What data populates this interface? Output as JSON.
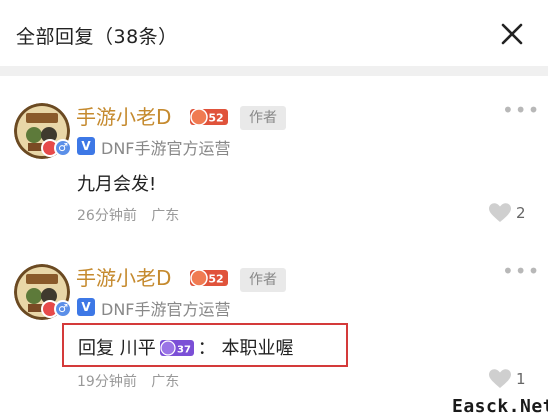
{
  "header": {
    "title": "全部回复（38条）"
  },
  "comments": [
    {
      "username": "手游小老D",
      "level": "52",
      "author_tag": "作者",
      "verify_label": "V",
      "verify_text": "DNF手游官方运营",
      "content": "九月会发!",
      "time": "26分钟前",
      "location": "广东",
      "likes": "2"
    },
    {
      "username": "手游小老D",
      "level": "52",
      "author_tag": "作者",
      "verify_label": "V",
      "verify_text": "DNF手游官方运营",
      "reply_prefix": "回复",
      "reply_to": "川平",
      "reply_to_level": "37",
      "reply_colon": "：",
      "reply_content": "本职业喔",
      "time": "19分钟前",
      "location": "广东",
      "likes": "1"
    }
  ],
  "watermark": "Easck.Net",
  "icons": {
    "close": "close-icon",
    "more": "more-icon",
    "like": "heart-icon"
  },
  "colors": {
    "username": "#c58a2e",
    "highlight_border": "#d43a3a",
    "level_badge": "#e0533b",
    "reply_badge": "#7b4fd6",
    "verify": "#3d78e6"
  }
}
